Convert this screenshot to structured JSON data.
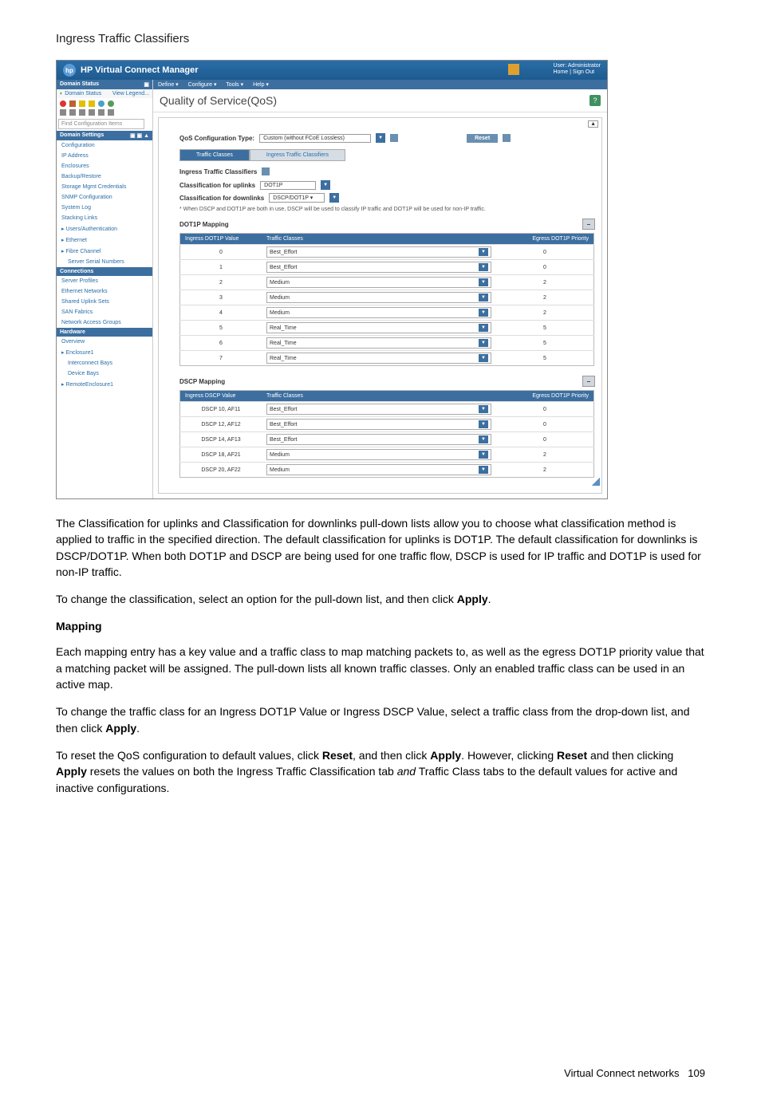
{
  "page_title": "Ingress Traffic Classifiers",
  "screenshot": {
    "app_title": "HP Virtual Connect Manager",
    "user_block": {
      "line1": "User: Administrator",
      "line2": "Home | Sign Out"
    },
    "menu": [
      "Define ▾",
      "Configure ▾",
      "Tools ▾",
      "Help ▾"
    ],
    "sidebar": {
      "domain_status_header": "Domain Status",
      "domain_status_sub": "Domain Status",
      "view_legend": "View Legend...",
      "search_placeholder": "Find Configuration Items",
      "domain_settings_header": "Domain Settings",
      "items": [
        "Configuration",
        "IP Address",
        "Enclosures",
        "Backup/Restore",
        "Storage Mgmt Credentials",
        "SNMP Configuration",
        "System Log",
        "Stacking Links"
      ],
      "users_auth": "Users/Authentication",
      "ethernet": "Ethernet",
      "fibre_channel": "Fibre Channel",
      "sub_items": [
        "Server Serial Numbers"
      ],
      "connections_header": "Connections",
      "conn_items": [
        "Server Profiles",
        "Ethernet Networks",
        "Shared Uplink Sets",
        "SAN Fabrics",
        "Network Access Groups"
      ],
      "hardware_header": "Hardware",
      "hw_items": [
        "Overview",
        "Enclosure1"
      ],
      "hw_sub": [
        "Interconnect Bays",
        "Device Bays"
      ],
      "remote": "RemoteEnclosure1"
    },
    "content": {
      "title": "Quality of Service(QoS)",
      "config_type_label": "QoS Configuration Type:",
      "config_type_value": "Custom (without FCoE Lossless)",
      "reset_btn": "Reset",
      "tab_traffic_classes": "Traffic Classes",
      "tab_ingress": "Ingress Traffic Classifiers",
      "section_ingress": "Ingress Traffic Classifiers",
      "uplinks_label": "Classification for uplinks",
      "uplinks_value": "DOT1P",
      "downlinks_label": "Classification for downlinks",
      "downlinks_value": "DSCP/DOT1P ▾",
      "note": "* When DSCP and DOT1P are both in use, DSCP will be used to classify IP traffic and DOT1P will be used for non-IP traffic.",
      "dot1p_mapping_label": "DOT1P Mapping",
      "dot1p_headers": [
        "Ingress DOT1P Value",
        "Traffic Classes",
        "Egress DOT1P Priority"
      ],
      "dot1p_rows": [
        {
          "v": "0",
          "tc": "Best_Effort",
          "p": "0"
        },
        {
          "v": "1",
          "tc": "Best_Effort",
          "p": "0"
        },
        {
          "v": "2",
          "tc": "Medium",
          "p": "2"
        },
        {
          "v": "3",
          "tc": "Medium",
          "p": "2"
        },
        {
          "v": "4",
          "tc": "Medium",
          "p": "2"
        },
        {
          "v": "5",
          "tc": "Real_Time",
          "p": "5"
        },
        {
          "v": "6",
          "tc": "Real_Time",
          "p": "5"
        },
        {
          "v": "7",
          "tc": "Real_Time",
          "p": "5"
        }
      ],
      "dscp_mapping_label": "DSCP Mapping",
      "dscp_headers": [
        "Ingress DSCP Value",
        "Traffic Classes",
        "Egress DOT1P Priority"
      ],
      "dscp_rows": [
        {
          "v": "DSCP 10, AF11",
          "tc": "Best_Effort",
          "p": "0"
        },
        {
          "v": "DSCP 12, AF12",
          "tc": "Best_Effort",
          "p": "0"
        },
        {
          "v": "DSCP 14, AF13",
          "tc": "Best_Effort",
          "p": "0"
        },
        {
          "v": "DSCP 18, AF21",
          "tc": "Medium",
          "p": "2"
        },
        {
          "v": "DSCP 20, AF22",
          "tc": "Medium",
          "p": "2"
        }
      ]
    }
  },
  "paragraphs": {
    "p1a": "The Classification for uplinks and Classification for downlinks pull-down lists allow you to choose what classification method is applied to traffic in the specified direction. The default classification for uplinks is DOT1P. The default classification for downlinks is DSCP/DOT1P. When both DOT1P and DSCP are being used for one traffic flow, DSCP is used for IP traffic and DOT1P is used for non-IP traffic.",
    "p2_pre": "To change the classification, select an option for the pull-down list, and then click ",
    "apply": "Apply",
    "p2_post": ".",
    "mapping_heading": "Mapping",
    "p3": "Each mapping entry has a key value and a traffic class to map matching packets to, as well as the egress DOT1P priority value that a matching packet will be assigned. The pull-down lists all known traffic classes. Only an enabled traffic class can be used in an active map.",
    "p4_pre": "To change the traffic class for an Ingress DOT1P Value or Ingress DSCP Value, select a traffic class from the drop-down list, and then click ",
    "p5_pre": "To reset the QoS configuration to default values, click ",
    "reset": "Reset",
    "p5_mid1": ", and then click ",
    "p5_mid2": ". However, clicking ",
    "p5_mid3": " and then clicking ",
    "p5_mid4": " resets the values on both the Ingress Traffic Classification tab ",
    "and_italic": "and",
    "p5_end": " Traffic Class tabs to the default values for active and inactive configurations."
  },
  "footer": {
    "text": "Virtual Connect networks",
    "page": "109"
  }
}
